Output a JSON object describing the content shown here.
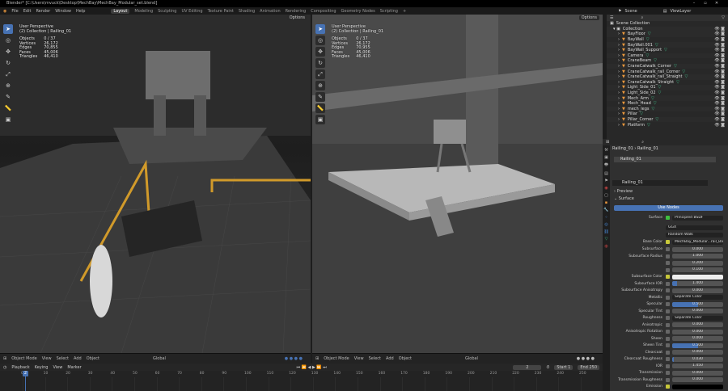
{
  "titlebar": {
    "title": "Blender* [C:\\Users\\mvuck\\Desktop\\MechBay\\MechBay_Modular_set.blend]"
  },
  "menu": [
    "File",
    "Edit",
    "Render",
    "Window",
    "Help"
  ],
  "workspaces": [
    {
      "label": "Layout",
      "active": true
    },
    {
      "label": "Modeling"
    },
    {
      "label": "Sculpting"
    },
    {
      "label": "UV Editing"
    },
    {
      "label": "Texture Paint"
    },
    {
      "label": "Shading"
    },
    {
      "label": "Animation"
    },
    {
      "label": "Rendering"
    },
    {
      "label": "Compositing"
    },
    {
      "label": "Geometry Nodes"
    },
    {
      "label": "Scripting"
    },
    {
      "label": "+"
    }
  ],
  "scene": {
    "name": "Scene",
    "view_layer": "ViewLayer"
  },
  "viewports": [
    {
      "options": "Options",
      "perspective": "User Perspective",
      "collection": "(2) Collection | Railing_01",
      "stats": [
        [
          "Objects",
          "0 / 37"
        ],
        [
          "Vertices",
          "26,172"
        ],
        [
          "Edges",
          "70,855"
        ],
        [
          "Faces",
          "45,006"
        ],
        [
          "Triangles",
          "46,410"
        ]
      ],
      "shading": "rendered"
    },
    {
      "options": "Options",
      "perspective": "User Perspective",
      "collection": "(2) Collection | Railing_01",
      "stats": [
        [
          "Objects",
          "0 / 37"
        ],
        [
          "Vertices",
          "26,172"
        ],
        [
          "Edges",
          "70,955"
        ],
        [
          "Faces",
          "45,006"
        ],
        [
          "Triangles",
          "46,410"
        ]
      ],
      "shading": "solid"
    }
  ],
  "viewport_header": {
    "mode": "Object Mode",
    "menus": [
      "View",
      "Select",
      "Add",
      "Object"
    ],
    "orientation": "Global"
  },
  "timeline": {
    "menus": [
      "Playback",
      "Keying",
      "View",
      "Marker"
    ],
    "current_frame": "2",
    "start_label": "Start",
    "start": "1",
    "end_label": "End",
    "end": "250",
    "ticks": [
      "0",
      "10",
      "20",
      "30",
      "40",
      "50",
      "60",
      "70",
      "80",
      "90",
      "100",
      "110",
      "120",
      "130",
      "140",
      "150",
      "160",
      "170",
      "180",
      "190",
      "200",
      "210",
      "220",
      "230",
      "240",
      "250"
    ]
  },
  "outliner": {
    "root": "Scene Collection",
    "collection": "Collection",
    "items": [
      "BayFloor",
      "BayWall",
      "BayWall.001",
      "BayWall_Support",
      "Camera",
      "CraneBeam",
      "CraneCatwalk_Corner",
      "CraneCatwalk_rail_Corner",
      "CraneCatwalk_rail_Straight",
      "CraneCatwalk_Straight",
      "Light_Side_01",
      "Light_Side_02",
      "Mech_Arm",
      "Mech_Head",
      "mech_legs",
      "Pillar",
      "Pillar_Corner",
      "Platform"
    ]
  },
  "properties": {
    "breadcrumb": [
      "Railing_01",
      "Railing_01"
    ],
    "slot": "Railing_01",
    "material": "Railing_01",
    "preview": "Preview",
    "surface_panel": "Surface",
    "use_nodes": "Use Nodes",
    "surface": {
      "label": "Surface",
      "value": "Principled BSDF"
    },
    "distribution": "GGX",
    "subsurface_method": "Random Walk",
    "base_color": {
      "label": "Base Color",
      "value": "MechBay_Modular...rail_BaseColor.png"
    },
    "rows": [
      {
        "label": "Subsurface",
        "value": "0.000",
        "fill": 0
      },
      {
        "label": "Subsurface Radius",
        "value": "1.000",
        "fill": 0
      },
      {
        "label": "",
        "value": "0.200",
        "fill": 0
      },
      {
        "label": "",
        "value": "0.100",
        "fill": 0
      },
      {
        "label": "Subsurface Color",
        "value": "",
        "color": "#eeeeee"
      },
      {
        "label": "Subsurface IOR",
        "value": "1.400",
        "fill": 0.1
      },
      {
        "label": "Subsurface Anisotropy",
        "value": "0.000",
        "fill": 0
      },
      {
        "label": "Metallic",
        "value": "Separate Color",
        "link": true
      },
      {
        "label": "Specular",
        "value": "0.500",
        "fill": 0.5
      },
      {
        "label": "Specular Tint",
        "value": "0.000",
        "fill": 0
      },
      {
        "label": "Roughness",
        "value": "Separate Color",
        "link": true
      },
      {
        "label": "Anisotropic",
        "value": "0.000",
        "fill": 0
      },
      {
        "label": "Anisotropic Rotation",
        "value": "0.000",
        "fill": 0
      },
      {
        "label": "Sheen",
        "value": "0.000",
        "fill": 0
      },
      {
        "label": "Sheen Tint",
        "value": "0.500",
        "fill": 0.5
      },
      {
        "label": "Clearcoat",
        "value": "0.000",
        "fill": 0
      },
      {
        "label": "Clearcoat Roughness",
        "value": "0.030",
        "fill": 0.03
      },
      {
        "label": "IOR",
        "value": "1.450",
        "fill": 0
      },
      {
        "label": "Transmission",
        "value": "0.000",
        "fill": 0
      },
      {
        "label": "Transmission Roughness",
        "value": "0.000",
        "fill": 0
      },
      {
        "label": "Emission",
        "value": "",
        "color": "#000000"
      }
    ]
  },
  "colors": {
    "accent": "#4772b3",
    "object": "#e8973d",
    "mesh_data": "#3fbf8a",
    "railing": "#d19a2a"
  }
}
